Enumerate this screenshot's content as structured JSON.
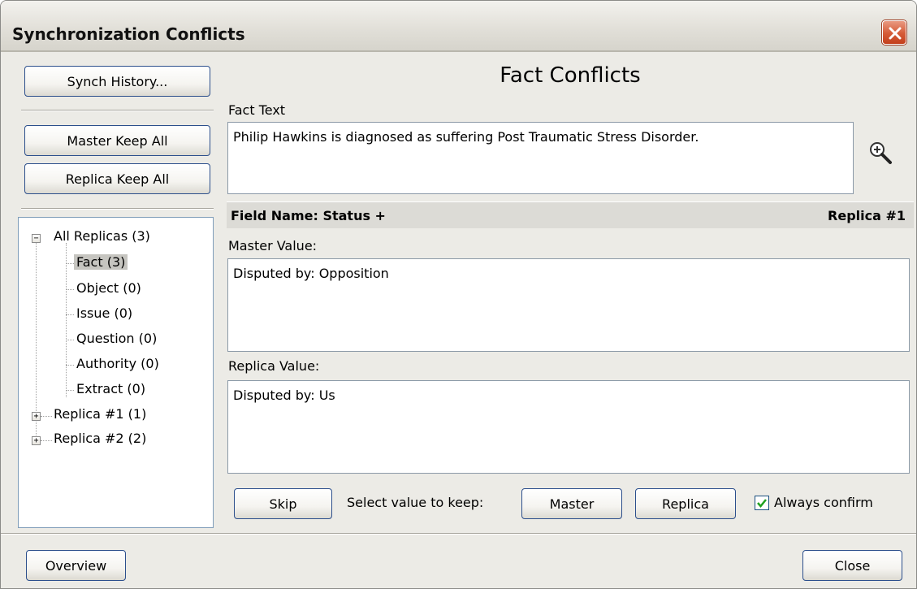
{
  "window": {
    "title": "Synchronization Conflicts"
  },
  "sidebar": {
    "synch_history_label": "Synch History...",
    "master_keep_all_label": "Master Keep All",
    "replica_keep_all_label": "Replica Keep All",
    "tree": {
      "root": "All Replicas (3)",
      "children": [
        "Fact (3)",
        "Object (0)",
        "Issue (0)",
        "Question (0)",
        "Authority (0)",
        "Extract (0)"
      ],
      "replicas": [
        "Replica #1 (1)",
        "Replica #2 (2)"
      ],
      "selected": "Fact (3)",
      "root_expander": "−",
      "replica_expander": "+"
    }
  },
  "main": {
    "title": "Fact Conflicts",
    "fact_text_label": "Fact Text",
    "fact_text": "Philip Hawkins is diagnosed as suffering Post Traumatic Stress Disorder.",
    "field_name": "Field Name: Status +",
    "replica_name": "Replica #1",
    "master_value_label": "Master Value:",
    "master_value": "Disputed by:  Opposition",
    "replica_value_label": "Replica Value:",
    "replica_value": "Disputed by:  Us",
    "skip_label": "Skip",
    "select_value_label": "Select value to keep:",
    "master_button_label": "Master",
    "replica_button_label": "Replica",
    "always_confirm_label": "Always confirm",
    "always_confirm_checked": true
  },
  "footer": {
    "overview_label": "Overview",
    "close_label": "Close"
  },
  "icons": {
    "close": "close-icon",
    "zoom": "zoom-in-icon",
    "checkmark": "checkmark-icon"
  },
  "colors": {
    "close_button": "#d55a36",
    "button_border": "#2c4f8c",
    "checkmark": "#21a121"
  }
}
